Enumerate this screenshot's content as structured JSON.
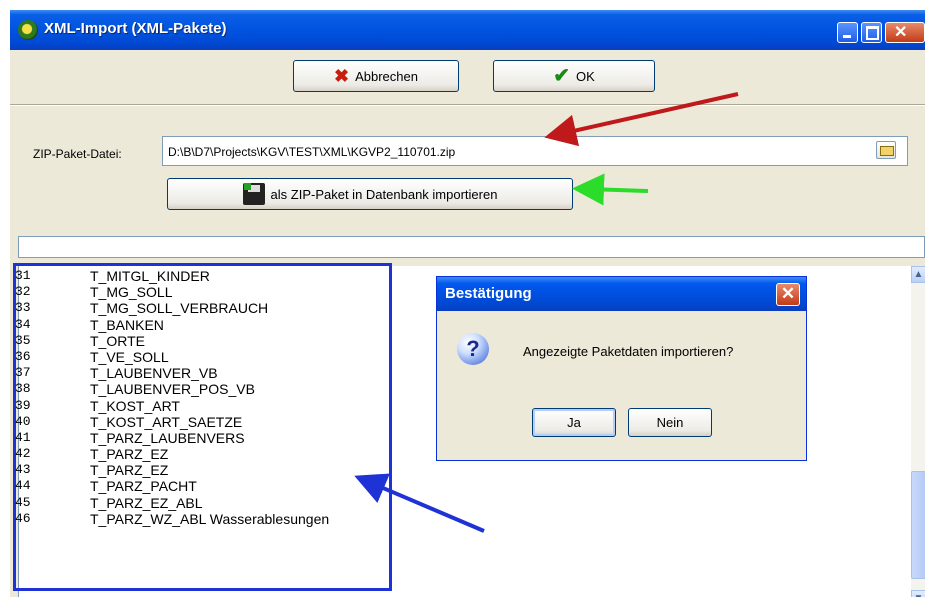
{
  "window": {
    "title": "XML-Import (XML-Pakete)",
    "icons": {
      "app": "app-icon",
      "minimize": "minimize-icon",
      "maximize": "maximize-icon",
      "close": "close-icon"
    },
    "close_glyph": "✕"
  },
  "toolbar": {
    "cancel_label": "Abbrechen",
    "cancel_glyph": "✖",
    "ok_label": "OK",
    "ok_glyph": "✔"
  },
  "zip": {
    "label": "ZIP-Paket-Datei:",
    "value": "D:\\B\\D7\\Projects\\KGV\\TEST\\XML\\KGVP2_110701.zip",
    "browse_icon": "folder-open-icon"
  },
  "import_button": {
    "label": "als ZIP-Paket in Datenbank importieren",
    "icon": "floppy-disk-icon"
  },
  "progress": {
    "value": 0
  },
  "list": {
    "rows": [
      {
        "num": "31",
        "name": "T_MITGL_KINDER"
      },
      {
        "num": "32",
        "name": "T_MG_SOLL"
      },
      {
        "num": "33",
        "name": "T_MG_SOLL_VERBRAUCH"
      },
      {
        "num": "34",
        "name": "T_BANKEN"
      },
      {
        "num": "35",
        "name": "T_ORTE"
      },
      {
        "num": "36",
        "name": "T_VE_SOLL"
      },
      {
        "num": "37",
        "name": "T_LAUBENVER_VB"
      },
      {
        "num": "38",
        "name": "T_LAUBENVER_POS_VB"
      },
      {
        "num": "39",
        "name": "T_KOST_ART"
      },
      {
        "num": "40",
        "name": "T_KOST_ART_SAETZE"
      },
      {
        "num": "41",
        "name": "T_PARZ_LAUBENVERS"
      },
      {
        "num": "42",
        "name": "T_PARZ_EZ"
      },
      {
        "num": "43",
        "name": "T_PARZ_EZ"
      },
      {
        "num": "44",
        "name": "T_PARZ_PACHT"
      },
      {
        "num": "45",
        "name": "T_PARZ_EZ_ABL"
      },
      {
        "num": "46",
        "name": "T_PARZ_WZ_ABL Wasserablesungen"
      }
    ],
    "scroll_up_glyph": "▲",
    "scroll_down_glyph": "▼"
  },
  "dialog": {
    "title": "Bestätigung",
    "message": "Angezeigte Paketdaten importieren?",
    "icon": "question-icon",
    "icon_glyph": "?",
    "close_glyph": "✕",
    "yes_label": "Ja",
    "no_label": "Nein"
  },
  "annotations": {
    "red_arrow_color": "#c0191b",
    "green_arrow_color": "#2bdc2b",
    "blue_arrow_color": "#1f32d6"
  }
}
